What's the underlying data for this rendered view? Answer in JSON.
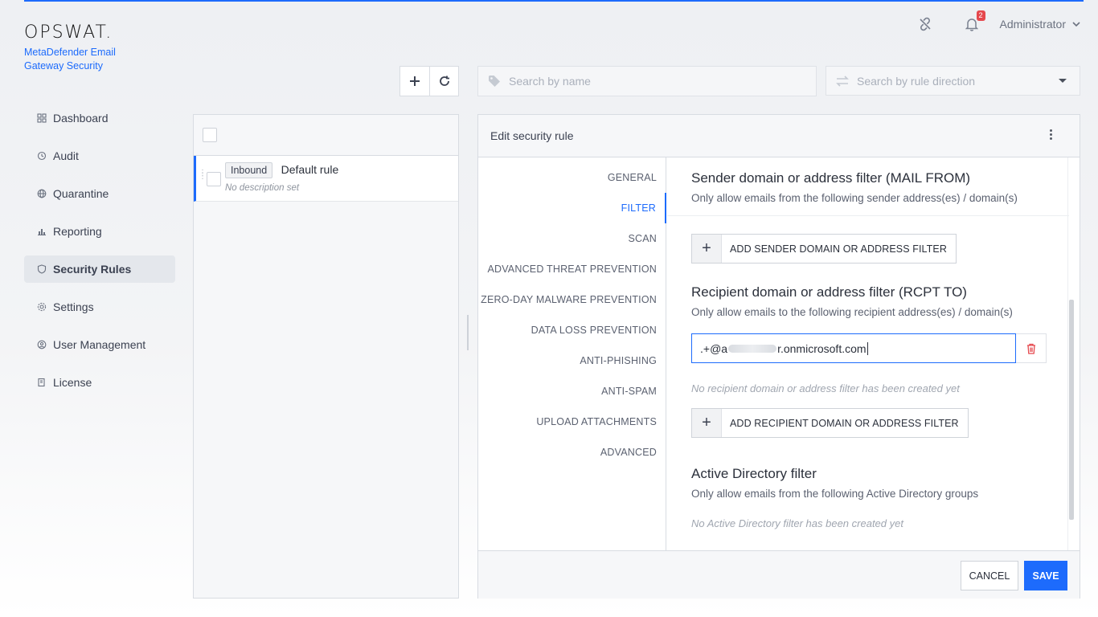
{
  "brand": {
    "logo": "OPSWAT.",
    "product": "MetaDefender Email Gateway Security"
  },
  "header": {
    "notification_count": "2",
    "user": "Administrator",
    "icons": [
      "unlink-icon",
      "bell-icon",
      "chevron-down-icon"
    ]
  },
  "sidebar": {
    "items": [
      {
        "label": "Dashboard",
        "icon": "grid-icon",
        "active": false
      },
      {
        "label": "Audit",
        "icon": "audit-icon",
        "active": false
      },
      {
        "label": "Quarantine",
        "icon": "globe-icon",
        "active": false
      },
      {
        "label": "Reporting",
        "icon": "chart-icon",
        "active": false
      },
      {
        "label": "Security Rules",
        "icon": "shield-icon",
        "active": true
      },
      {
        "label": "Settings",
        "icon": "gear-icon",
        "active": false
      },
      {
        "label": "User Management",
        "icon": "user-icon",
        "active": false
      },
      {
        "label": "License",
        "icon": "license-icon",
        "active": false
      }
    ]
  },
  "toolbar": {
    "search_name_placeholder": "Search by name",
    "search_direction_placeholder": "Search by rule direction"
  },
  "rules": [
    {
      "direction": "Inbound",
      "name": "Default rule",
      "description": "No description set"
    }
  ],
  "editor": {
    "title": "Edit security rule",
    "tabs": [
      "GENERAL",
      "FILTER",
      "SCAN",
      "ADVANCED THREAT PREVENTION",
      "ZERO-DAY MALWARE PREVENTION",
      "DATA LOSS PREVENTION",
      "ANTI-PHISHING",
      "ANTI-SPAM",
      "UPLOAD ATTACHMENTS",
      "ADVANCED"
    ],
    "active_tab": "FILTER",
    "sender": {
      "title": "Sender domain or address filter (MAIL FROM)",
      "subtitle": "Only allow emails from the following sender address(es) / domain(s)",
      "add_label": "ADD SENDER DOMAIN OR ADDRESS FILTER"
    },
    "recipient": {
      "title": "Recipient domain or address filter (RCPT TO)",
      "subtitle": "Only allow emails to the following recipient address(es) / domain(s)",
      "value_prefix": ".+@a",
      "value_suffix": "r.onmicrosoft.com",
      "empty_note": "No recipient domain or address filter has been created yet",
      "add_label": "ADD RECIPIENT DOMAIN OR ADDRESS FILTER"
    },
    "active_directory": {
      "title": "Active Directory filter",
      "subtitle": "Only allow emails from the following Active Directory groups",
      "empty_note": "No Active Directory filter has been created yet"
    },
    "cancel_label": "CANCEL",
    "save_label": "SAVE"
  },
  "colors": {
    "accent": "#1d6bfc",
    "danger": "#e5484d"
  }
}
